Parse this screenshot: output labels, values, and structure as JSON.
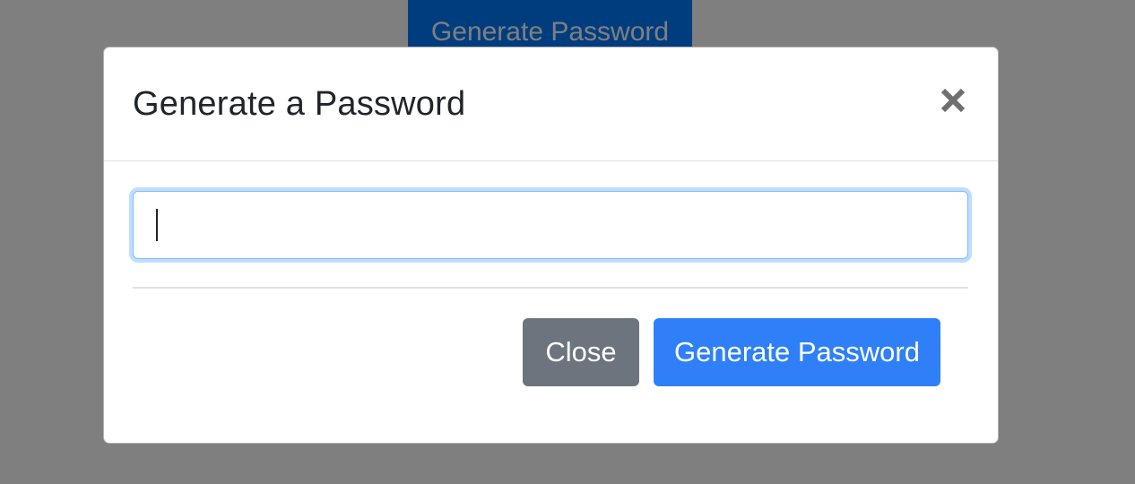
{
  "background": {
    "button_label": "Generate Password"
  },
  "modal": {
    "title": "Generate a Password",
    "close_icon": "close-icon",
    "password_input": {
      "value": "",
      "placeholder": ""
    },
    "footer": {
      "close_label": "Close",
      "generate_label": "Generate Password"
    }
  },
  "colors": {
    "primary": "#2f80f8",
    "secondary": "#6c757d",
    "backdrop": "rgba(0,0,0,0.5)"
  }
}
